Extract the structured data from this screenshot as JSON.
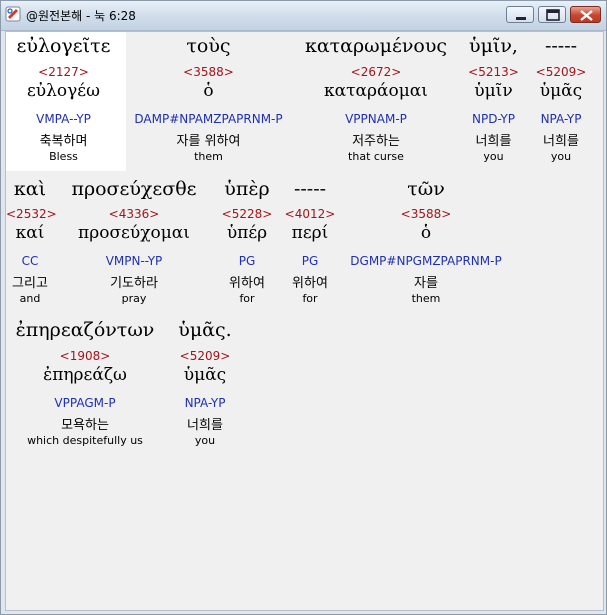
{
  "window": {
    "title": "@원전본해 - 눅 6:28",
    "icon": "bible-app-icon",
    "buttons": [
      "minimize-icon",
      "maximize-icon",
      "close-icon"
    ]
  },
  "words": [
    {
      "greek": "εὐλογεῖτε",
      "strong": "<2127>",
      "lemma": "εὐλογέω",
      "morph": "VMPA--YP",
      "korean": "축복하며",
      "english": "Bless"
    },
    {
      "greek": "τοὺς",
      "strong": "<3588>",
      "lemma": "ὁ",
      "morph": "DAMP#NPAMZPAPRNM-P",
      "korean": "자를 위하여",
      "english": "them"
    },
    {
      "greek": "καταρωμένους",
      "strong": "<2672>",
      "lemma": "καταράομαι",
      "morph": "VPPNAM-P",
      "korean": "저주하는",
      "english": "that curse"
    },
    {
      "greek": "ὑμῖν,",
      "strong": "<5213>",
      "lemma": "ὑμῖν",
      "morph": "NPD-YP",
      "korean": "너희를",
      "english": "you"
    },
    {
      "greek": "-----",
      "strong": "<5209>",
      "lemma": "ὑμᾶς",
      "morph": "NPA-YP",
      "korean": "너희를",
      "english": "you"
    },
    {
      "greek": "καὶ",
      "strong": "<2532>",
      "lemma": "καί",
      "morph": "CC",
      "korean": "그리고",
      "english": "and"
    },
    {
      "greek": "προσεύχεσθε",
      "strong": "<4336>",
      "lemma": "προσεύχομαι",
      "morph": "VMPN--YP",
      "korean": "기도하라",
      "english": "pray"
    },
    {
      "greek": "ὑπὲρ",
      "strong": "<5228>",
      "lemma": "ὑπέρ",
      "morph": "PG",
      "korean": "위하여",
      "english": "for"
    },
    {
      "greek": "-----",
      "strong": "<4012>",
      "lemma": "περί",
      "morph": "PG",
      "korean": "위하여",
      "english": "for"
    },
    {
      "greek": "τῶν",
      "strong": "<3588>",
      "lemma": "ὁ",
      "morph": "DGMP#NPGMZPAPRNM-P",
      "korean": "자를",
      "english": "them"
    },
    {
      "greek": "ἐπηρεαζόντων",
      "strong": "<1908>",
      "lemma": "ἐπηρεάζω",
      "morph": "VPPAGM-P",
      "korean": "모욕하는",
      "english": "which despitefully us"
    },
    {
      "greek": "ὑμᾶς.",
      "strong": "<5209>",
      "lemma": "ὑμᾶς",
      "morph": "NPA-YP",
      "korean": "너희를",
      "english": "you"
    }
  ]
}
